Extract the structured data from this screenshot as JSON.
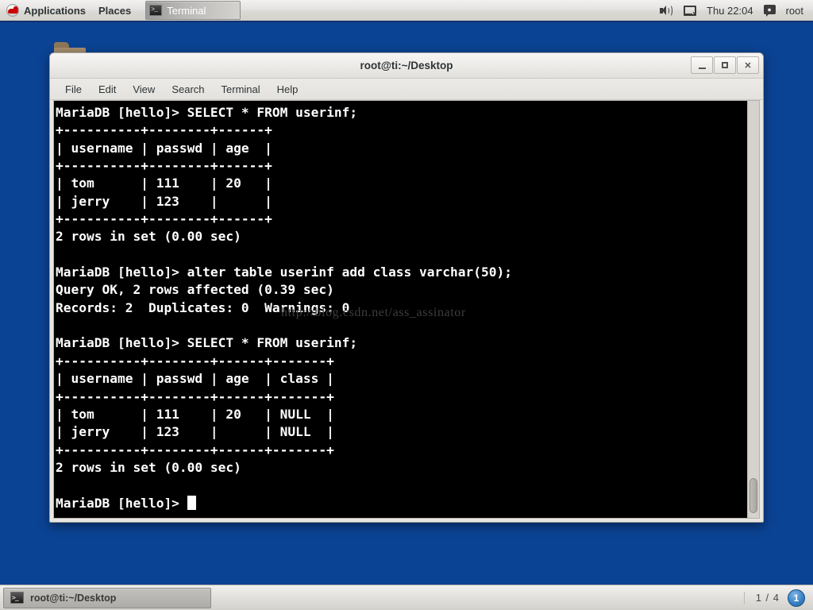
{
  "top_panel": {
    "applications_label": "Applications",
    "places_label": "Places",
    "window_button": "Terminal",
    "clock": "Thu 22:04",
    "user": "root",
    "icons": {
      "menu_logo": "redhat-logo-icon",
      "window_icon": "terminal-icon",
      "volume": "volume-icon",
      "network": "network-disconnected-icon",
      "user": "user-icon"
    }
  },
  "desktop": {
    "folder_icon": "folder-icon"
  },
  "terminal": {
    "title": "root@ti:~/Desktop",
    "menu": [
      "File",
      "Edit",
      "View",
      "Search",
      "Terminal",
      "Help"
    ],
    "controls": {
      "minimize": "_",
      "maximize": "□",
      "close": "✕"
    },
    "watermark": "http://blog.csdn.net/ass_assinator",
    "lines": [
      "MariaDB [hello]> SELECT * FROM userinf;",
      "+----------+--------+------+",
      "| username | passwd | age  |",
      "+----------+--------+------+",
      "| tom      | 111    | 20   |",
      "| jerry    | 123    |      |",
      "+----------+--------+------+",
      "2 rows in set (0.00 sec)",
      "",
      "MariaDB [hello]> alter table userinf add class varchar(50);",
      "Query OK, 2 rows affected (0.39 sec)",
      "Records: 2  Duplicates: 0  Warnings: 0",
      "",
      "MariaDB [hello]> SELECT * FROM userinf;",
      "+----------+--------+------+-------+",
      "| username | passwd | age  | class |",
      "+----------+--------+------+-------+",
      "| tom      | 111    | 20   | NULL  |",
      "| jerry    | 123    |      | NULL  |",
      "+----------+--------+------+-------+",
      "2 rows in set (0.00 sec)",
      "",
      "MariaDB [hello]> "
    ],
    "prompt_last": "MariaDB [hello]> ",
    "tables": [
      {
        "columns": [
          "username",
          "passwd",
          "age"
        ],
        "rows": [
          [
            "tom",
            "111",
            "20"
          ],
          [
            "jerry",
            "123",
            ""
          ]
        ],
        "footer": "2 rows in set (0.00 sec)"
      },
      {
        "columns": [
          "username",
          "passwd",
          "age",
          "class"
        ],
        "rows": [
          [
            "tom",
            "111",
            "20",
            "NULL"
          ],
          [
            "jerry",
            "123",
            "",
            "NULL"
          ]
        ],
        "footer": "2 rows in set (0.00 sec)"
      }
    ],
    "commands": [
      "SELECT * FROM userinf;",
      "alter table userinf add class varchar(50);",
      "SELECT * FROM userinf;"
    ],
    "alter_result": {
      "status": "Query OK, 2 rows affected (0.39 sec)",
      "records": "Records: 2  Duplicates: 0  Warnings: 0"
    }
  },
  "bottom_panel": {
    "task_label": "root@ti:~/Desktop",
    "workspace_count": "1 / 4",
    "workspace_current": "1"
  },
  "colors": {
    "desktop_bg": "#0b4394",
    "panel_bg": "#dcdad5",
    "terminal_bg": "#000000",
    "terminal_fg": "#ffffff",
    "accent": "#13316b"
  }
}
